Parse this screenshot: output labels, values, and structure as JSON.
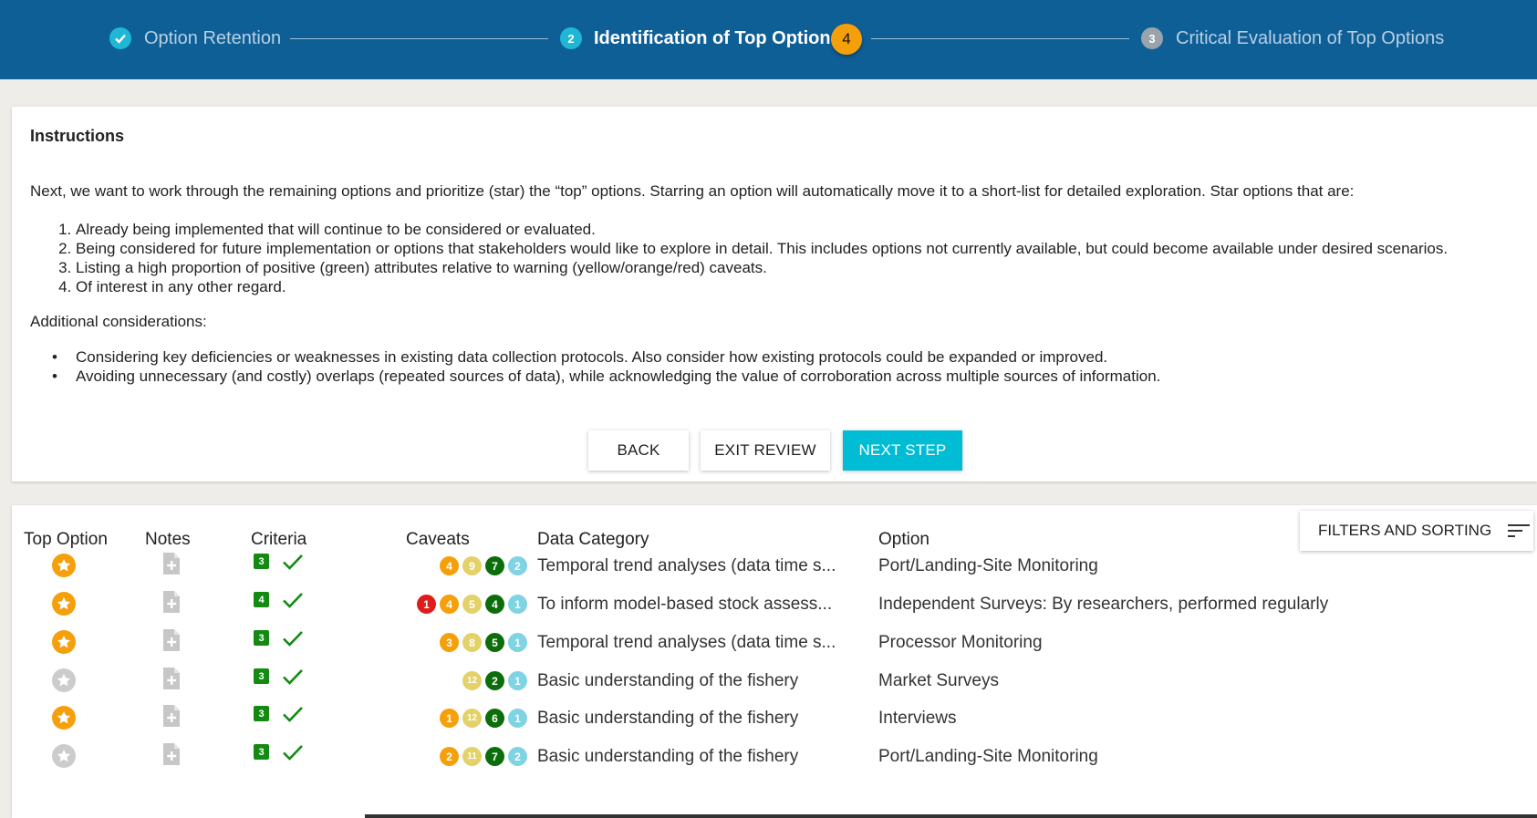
{
  "stepper": {
    "steps": [
      {
        "number": "",
        "label": "Option Retention",
        "state": "done"
      },
      {
        "number": "2",
        "label": "Identification of Top Options",
        "state": "active",
        "badge": "4"
      },
      {
        "number": "3",
        "label": "Critical Evaluation of Top Options",
        "state": "pending"
      }
    ]
  },
  "instructions": {
    "title": "Instructions",
    "intro": "Next, we want to work through the remaining options and prioritize (star) the “top” options. Starring an option will automatically move it to a short-list for detailed exploration. Star options that are:",
    "ordered": [
      "Already being implemented that will continue to be considered or evaluated.",
      "Being considered for future implementation or options that stakeholders would like to explore in detail. This includes options not currently available, but could become available under desired scenarios.",
      "Listing a high proportion of positive (green) attributes relative to warning (yellow/orange/red) caveats.",
      "Of interest in any other regard."
    ],
    "additional_label": "Additional considerations:",
    "bullets": [
      "Considering key deficiencies or weaknesses in existing data collection protocols. Also consider how existing protocols could be expanded or improved.",
      "Avoiding unnecessary (and costly) overlaps (repeated sources of data), while acknowledging the value of corroboration across multiple sources of information."
    ],
    "buttons": {
      "back": "BACK",
      "exit": "EXIT REVIEW",
      "next": "NEXT STEP"
    }
  },
  "table": {
    "headers": {
      "top_option": "Top Option",
      "notes": "Notes",
      "criteria": "Criteria",
      "caveats": "Caveats",
      "data_category": "Data Category",
      "option": "Option"
    },
    "filters_label": "FILTERS AND SORTING",
    "rows": [
      {
        "starred": true,
        "criteria": "3",
        "caveats": [
          {
            "n": "4",
            "c": "orange"
          },
          {
            "n": "9",
            "c": "yellow"
          },
          {
            "n": "7",
            "c": "green"
          },
          {
            "n": "2",
            "c": "blue"
          }
        ],
        "category": "Temporal trend analyses (data time s...",
        "option": "Port/Landing-Site Monitoring"
      },
      {
        "starred": true,
        "criteria": "4",
        "caveats": [
          {
            "n": "1",
            "c": "red"
          },
          {
            "n": "4",
            "c": "orange"
          },
          {
            "n": "5",
            "c": "yellow"
          },
          {
            "n": "4",
            "c": "green"
          },
          {
            "n": "1",
            "c": "blue"
          }
        ],
        "category": "To inform model-based stock assess...",
        "option": "Independent Surveys: By researchers, performed regularly"
      },
      {
        "starred": true,
        "criteria": "3",
        "caveats": [
          {
            "n": "3",
            "c": "orange"
          },
          {
            "n": "8",
            "c": "yellow"
          },
          {
            "n": "5",
            "c": "green"
          },
          {
            "n": "1",
            "c": "blue"
          }
        ],
        "category": "Temporal trend analyses (data time s...",
        "option": "Processor Monitoring"
      },
      {
        "starred": false,
        "criteria": "3",
        "caveats": [
          {
            "n": "12",
            "c": "yellow"
          },
          {
            "n": "2",
            "c": "green"
          },
          {
            "n": "1",
            "c": "blue"
          }
        ],
        "category": "Basic understanding of the fishery",
        "option": "Market Surveys"
      },
      {
        "starred": true,
        "criteria": "3",
        "caveats": [
          {
            "n": "1",
            "c": "orange"
          },
          {
            "n": "12",
            "c": "yellow"
          },
          {
            "n": "6",
            "c": "green"
          },
          {
            "n": "1",
            "c": "blue"
          }
        ],
        "category": "Basic understanding of the fishery",
        "option": "Interviews"
      },
      {
        "starred": false,
        "criteria": "3",
        "caveats": [
          {
            "n": "2",
            "c": "orange"
          },
          {
            "n": "11",
            "c": "yellow"
          },
          {
            "n": "7",
            "c": "green"
          },
          {
            "n": "2",
            "c": "blue"
          }
        ],
        "category": "Basic understanding of the fishery",
        "option": "Port/Landing-Site Monitoring"
      }
    ]
  },
  "colors": {
    "header_bg": "#0f5f97",
    "accent": "#00bcd4",
    "star_on": "#f5a00a",
    "star_off": "#cccccc",
    "criteria_green": "#138a12",
    "caveat_red": "#e01b1b",
    "caveat_orange": "#f5a00a",
    "caveat_yellow": "#e3d16a",
    "caveat_green": "#0b6e0b",
    "caveat_blue": "#7fd3e3"
  },
  "icons": {
    "done_step": "check-circle-icon",
    "star": "star-icon",
    "note": "note-add-icon",
    "check": "checkmark-icon",
    "filter": "sort-lines-icon"
  }
}
